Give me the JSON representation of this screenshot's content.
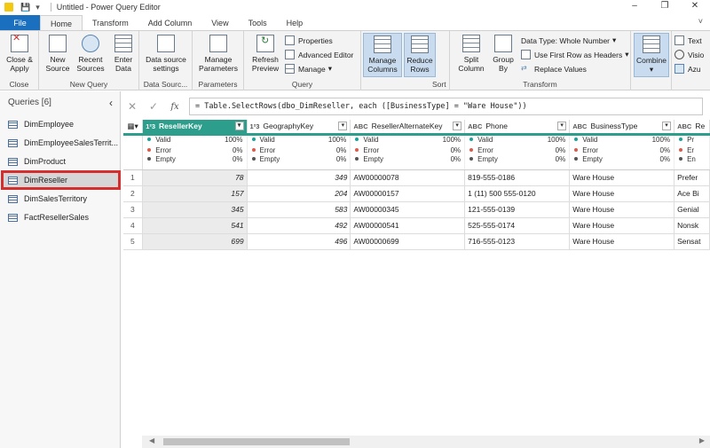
{
  "window": {
    "title": "Untitled - Power Query Editor",
    "controls": [
      "–",
      "❐",
      "✕"
    ]
  },
  "tabs": [
    "File",
    "Home",
    "Transform",
    "Add Column",
    "View",
    "Tools",
    "Help"
  ],
  "ribbon": {
    "close": {
      "btn": "Close &",
      "btn2": "Apply",
      "group": "Close"
    },
    "new_query": {
      "new_source": "New",
      "new_source2": "Source",
      "recent": "Recent",
      "recent2": "Sources",
      "enter": "Enter",
      "enter2": "Data",
      "group": "New Query"
    },
    "data_sources": {
      "btn": "Data source",
      "btn2": "settings",
      "group": "Data Sourc..."
    },
    "parameters": {
      "btn": "Manage",
      "btn2": "Parameters",
      "group": "Parameters"
    },
    "query": {
      "refresh": "Refresh",
      "refresh2": "Preview",
      "properties": "Properties",
      "advanced": "Advanced Editor",
      "manage": "Manage",
      "group": "Query"
    },
    "manage_cols": {
      "btn": "Manage",
      "btn2": "Columns"
    },
    "reduce_rows": {
      "btn": "Reduce",
      "btn2": "Rows"
    },
    "sort": {
      "group": "Sort"
    },
    "transform": {
      "split": "Split",
      "split2": "Column",
      "group_by": "Group",
      "group_by2": "By",
      "data_type": "Data Type: Whole Number",
      "first_row": "Use First Row as Headers",
      "replace": "Replace Values",
      "group": "Transform"
    },
    "combine": {
      "btn": "Combine"
    },
    "extra": {
      "text": "Text",
      "vision": "Visio",
      "azure": "Azu"
    }
  },
  "queries": {
    "header": "Queries [6]",
    "items": [
      "DimEmployee",
      "DimEmployeeSalesTerrit...",
      "DimProduct",
      "DimReseller",
      "DimSalesTerritory",
      "FactResellerSales"
    ],
    "selected": "DimReseller"
  },
  "formula": "= Table.SelectRows(dbo_DimReseller, each ([BusinessType] = \"Ware House\"))",
  "grid": {
    "columns": [
      {
        "name": "ResellerKey",
        "type": "1²3",
        "selected": true
      },
      {
        "name": "GeographyKey",
        "type": "1²3"
      },
      {
        "name": "ResellerAlternateKey",
        "type": "ABC"
      },
      {
        "name": "Phone",
        "type": "ABC"
      },
      {
        "name": "BusinessType",
        "type": "ABC"
      },
      {
        "name": "Re",
        "type": "ABC"
      }
    ],
    "profile_labels": [
      "Valid",
      "Error",
      "Empty"
    ],
    "profile_colors": [
      "#1aa39a",
      "#e05a4a",
      "#555555"
    ],
    "profile_values": [
      "100%",
      "0%",
      "0%"
    ],
    "profile_last_col": [
      "Pr",
      "Er",
      "En"
    ],
    "rows": [
      [
        "1",
        "78",
        "349",
        "AW00000078",
        "819-555-0186",
        "Ware House",
        "Prefer"
      ],
      [
        "2",
        "157",
        "204",
        "AW00000157",
        "1 (11) 500 555-0120",
        "Ware House",
        "Ace Bi"
      ],
      [
        "3",
        "345",
        "583",
        "AW00000345",
        "121-555-0139",
        "Ware House",
        "Genial"
      ],
      [
        "4",
        "541",
        "492",
        "AW00000541",
        "525-555-0174",
        "Ware House",
        "Nonsk"
      ],
      [
        "5",
        "699",
        "496",
        "AW00000699",
        "716-555-0123",
        "Ware House",
        "Sensat"
      ]
    ]
  }
}
